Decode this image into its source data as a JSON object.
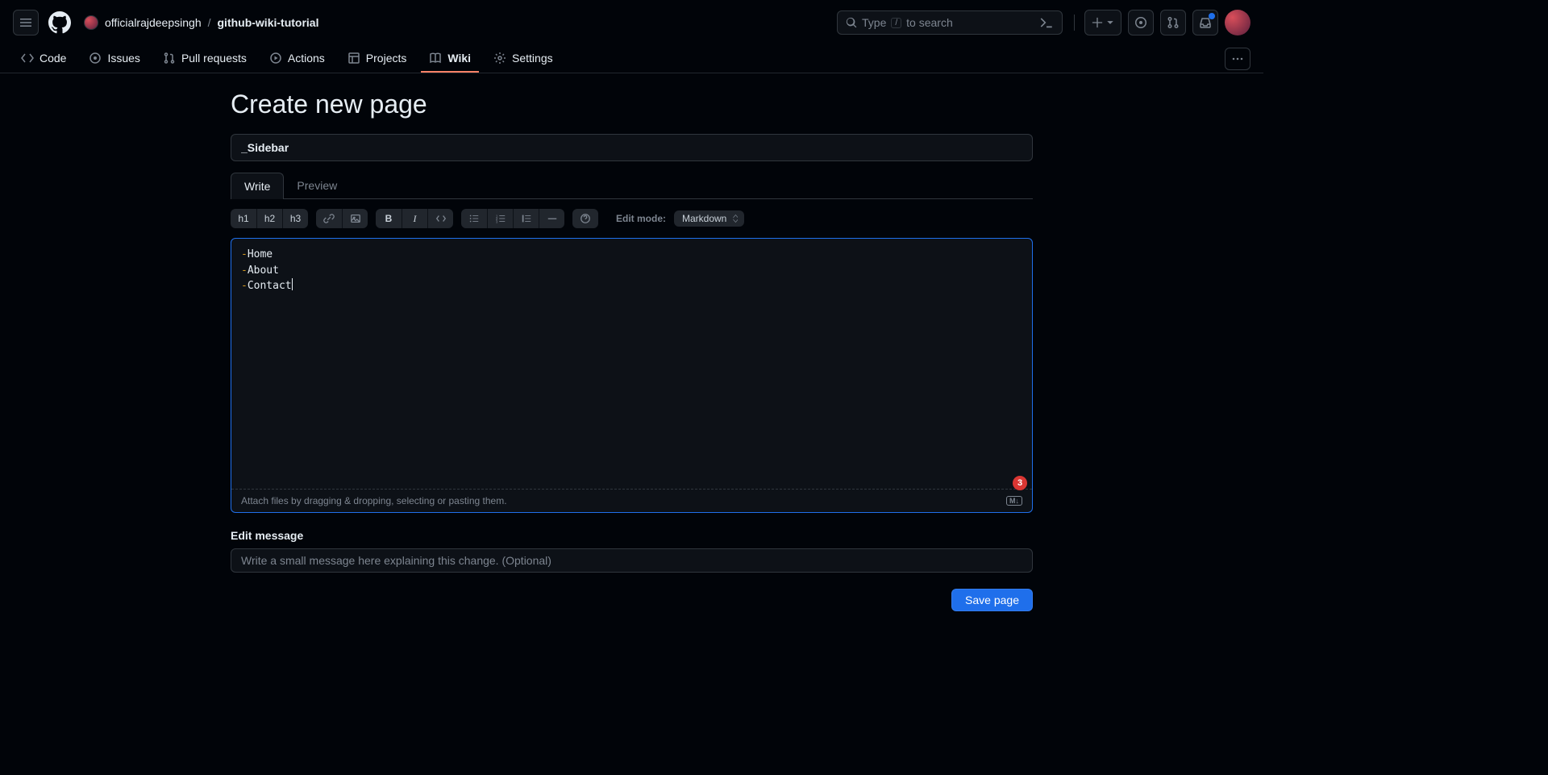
{
  "header": {
    "owner": "officialrajdeepsingh",
    "repo": "github-wiki-tutorial",
    "search_prefix": "Type",
    "search_kbd": "/",
    "search_suffix": "to search"
  },
  "nav": {
    "code": "Code",
    "issues": "Issues",
    "pulls": "Pull requests",
    "actions": "Actions",
    "projects": "Projects",
    "wiki": "Wiki",
    "settings": "Settings"
  },
  "page": {
    "title": "Create new page",
    "page_title_value": "_Sidebar",
    "tab_write": "Write",
    "tab_preview": "Preview",
    "toolbar": {
      "h1": "h1",
      "h2": "h2",
      "h3": "h3",
      "b": "B",
      "i": "I"
    },
    "edit_mode_label": "Edit mode:",
    "edit_mode_value": "Markdown",
    "content_lines": [
      "Home",
      "About",
      "Contact"
    ],
    "drop_text": "Attach files by dragging & dropping, selecting or pasting them.",
    "md_badge": "M↓",
    "error_badge": "3",
    "edit_msg_label": "Edit message",
    "edit_msg_placeholder": "Write a small message here explaining this change. (Optional)",
    "save_btn": "Save page"
  }
}
